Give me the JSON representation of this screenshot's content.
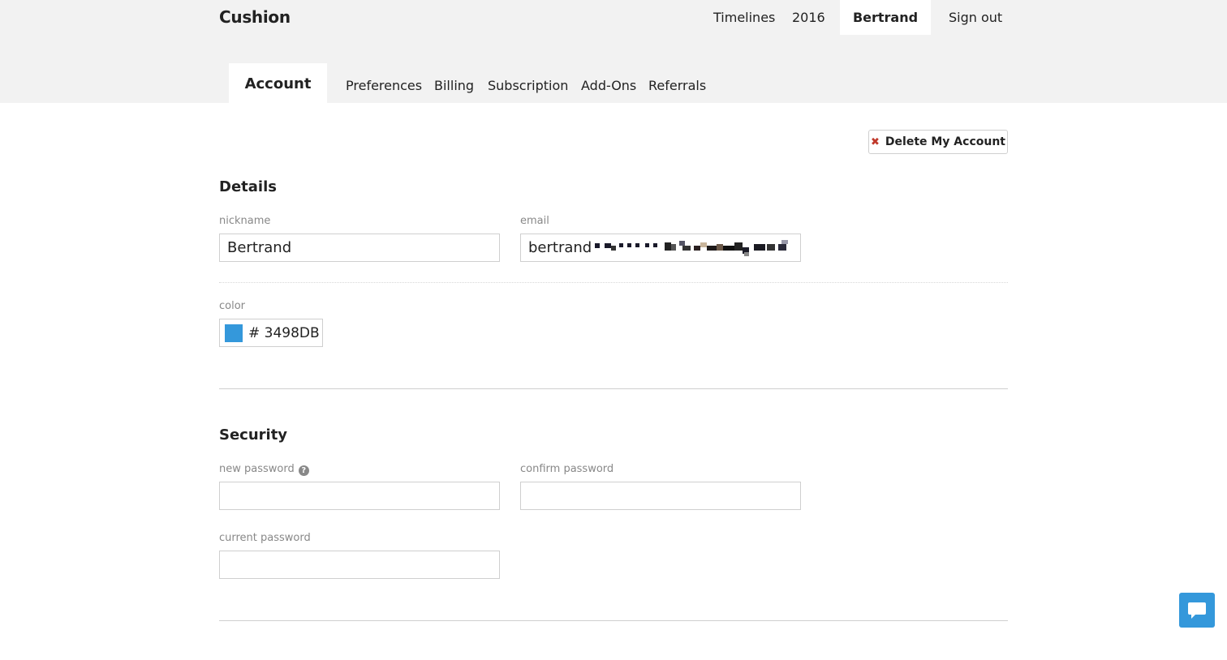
{
  "app": {
    "logo": "Cushion"
  },
  "topnav": {
    "items": [
      {
        "label": "Timelines"
      },
      {
        "label": "2016"
      },
      {
        "label": "Bertrand"
      },
      {
        "label": "Sign out"
      }
    ]
  },
  "tabs": [
    {
      "label": "Account"
    },
    {
      "label": "Preferences"
    },
    {
      "label": "Billing"
    },
    {
      "label": "Subscription"
    },
    {
      "label": "Add-Ons"
    },
    {
      "label": "Referrals"
    }
  ],
  "actions": {
    "delete_account_label": "Delete My Account",
    "delete_icon": "close-icon"
  },
  "details": {
    "title": "Details",
    "nickname_label": "nickname",
    "nickname_value": "Bertrand",
    "email_label": "email",
    "email_value": "bertrand",
    "color_label": "color",
    "color_value": "# 3498DB",
    "color_hex": "#3498DB"
  },
  "security": {
    "title": "Security",
    "new_password_label": "new password",
    "confirm_password_label": "confirm password",
    "current_password_label": "current password",
    "help_icon": "question-circle-icon"
  },
  "chat": {
    "icon": "chat-bubble-icon",
    "color": "#3498db"
  }
}
